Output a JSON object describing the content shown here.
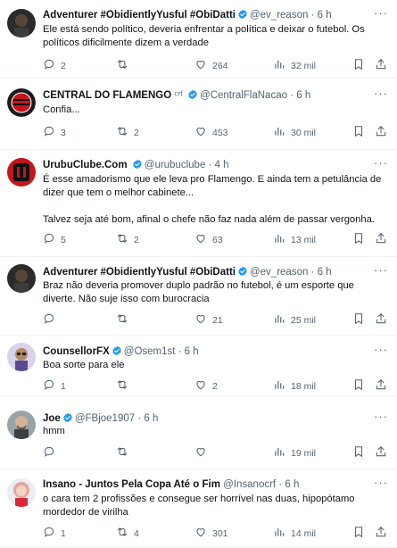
{
  "tweets": [
    {
      "display_name": "Adventurer #ObidientlyYusful #ObiDatti",
      "verified": true,
      "handle": "@ev_reason",
      "time": "· 6 h",
      "text": "Ele está sendo político, deveria enfrentar a política e deixar o futebol.  Os políticos dificilmente dizem a verdade",
      "replies": "2",
      "retweets": "",
      "likes": "264",
      "views": "32 mil",
      "avatar_icon": "dark-portrait-avatar"
    },
    {
      "display_name": "CENTRAL DO FLAMENGO",
      "name_suffix": " ᶜʳᶠ ",
      "verified": true,
      "handle": "@CentralFlaNacao",
      "time": "· 6 h",
      "text": "Confia...",
      "replies": "3",
      "retweets": "2",
      "likes": "453",
      "views": "30 mil",
      "avatar_icon": "flamengo-crest-avatar"
    },
    {
      "display_name": "UrubuClube.Com",
      "name_suffix": " ",
      "verified": true,
      "handle": "@urubuclube",
      "time": "· 4 h",
      "text": "É esse amadorismo que ele leva pro Flamengo. E ainda tem a petulância de dizer que tem o melhor cabinete...\n\nTalvez seja até bom, afinal o chefe não faz nada além de passar vergonha.",
      "replies": "5",
      "retweets": "2",
      "likes": "63",
      "views": "13 mil",
      "avatar_icon": "urubu-logo-avatar"
    },
    {
      "display_name": "Adventurer #ObidientlyYusful #ObiDatti",
      "verified": true,
      "handle": "@ev_reason",
      "time": "· 6 h",
      "text": "Braz não deveria promover duplo padrão no futebol, é um esporte que diverte.  Não suje isso com burocracia",
      "replies": "",
      "retweets": "",
      "likes": "21",
      "views": "25 mil",
      "avatar_icon": "dark-portrait-avatar"
    },
    {
      "display_name": "CounsellorFX",
      "verified": true,
      "handle": "@Osem1st",
      "time": "· 6 h",
      "text": "Boa sorte para ele",
      "replies": "1",
      "retweets": "",
      "likes": "2",
      "views": "18 mil",
      "avatar_icon": "cartoon-avatar"
    },
    {
      "display_name": "Joe",
      "verified": true,
      "handle": "@FBjoe1907",
      "time": "· 6 h",
      "text": "hmm",
      "replies": "",
      "retweets": "",
      "likes": "",
      "views": "19 mil",
      "avatar_icon": "man-portrait-avatar"
    },
    {
      "display_name": "Insano - Juntos Pela Copa Até o Fim",
      "verified": false,
      "handle": "@Insanocrf",
      "time": "· 6 h",
      "text": "o cara tem 2 profissões e consegue ser horrível nas duas, hipopótamo mordedor de virilha",
      "replies": "1",
      "retweets": "4",
      "likes": "301",
      "views": "14 mil",
      "avatar_icon": "woman-portrait-avatar"
    }
  ],
  "colors": {
    "verified": "#1d9bf0",
    "secondary_text": "#536471",
    "divider": "#eff3f4"
  }
}
